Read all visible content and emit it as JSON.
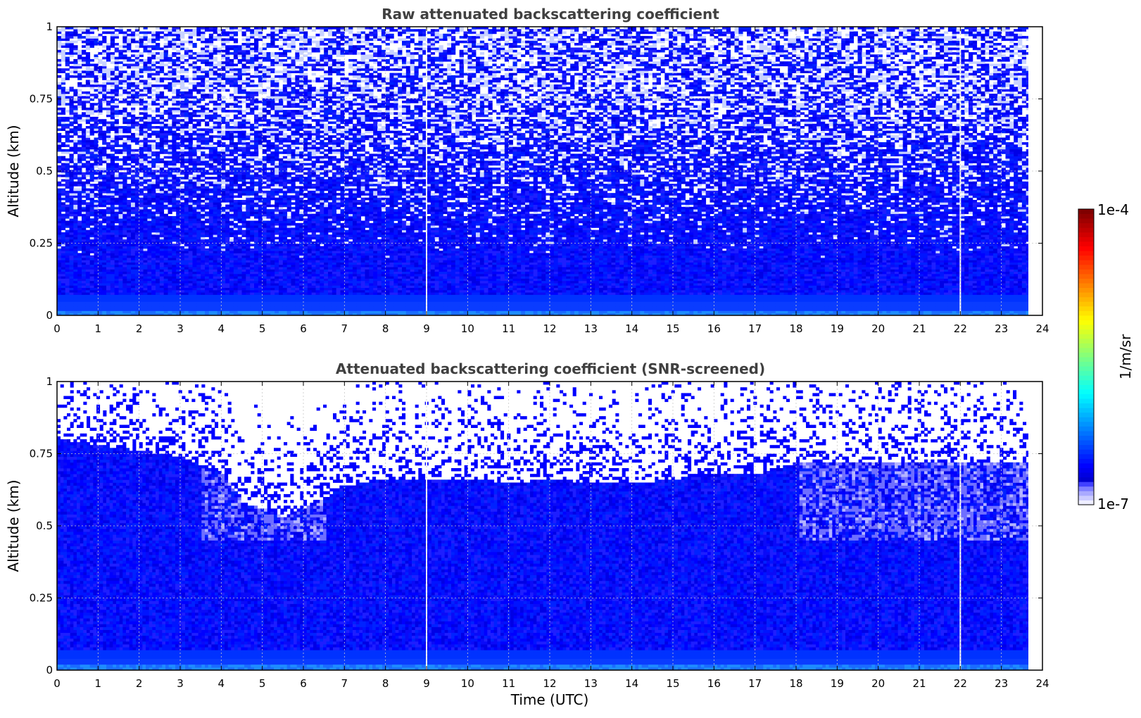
{
  "chart_data": [
    {
      "type": "heatmap",
      "title": "Raw attenuated backscattering coefficient",
      "xlabel": "",
      "ylabel": "Altitude (km)",
      "xlim": [
        0,
        24
      ],
      "ylim": [
        0,
        1
      ],
      "xticks": [
        "0",
        "1",
        "2",
        "3",
        "4",
        "5",
        "6",
        "7",
        "8",
        "9",
        "10",
        "11",
        "12",
        "13",
        "14",
        "15",
        "16",
        "17",
        "18",
        "19",
        "20",
        "21",
        "22",
        "23",
        "24"
      ],
      "yticks": [
        "0",
        "0.25",
        "0.5",
        "0.75",
        "1"
      ],
      "grid": true,
      "data_end_time": 23.65,
      "gaps_utc": [
        9.0,
        22.0
      ],
      "colorscale": "jet",
      "clim": [
        1e-07,
        0.0001
      ],
      "log_scale": true,
      "description_of_values": {
        "0.00-0.02 km": "bright blue, about 1e-6",
        "0.02-0.25 km": "blue, about 5e-7 to 8e-7",
        "0.25-0.5 km": "blue with sparse white speckle",
        "0.5-1.0 km": "mostly noisy white/blue speckle"
      }
    },
    {
      "type": "heatmap",
      "title": "Attenuated backscattering coefficient (SNR-screened)",
      "xlabel": "Time (UTC)",
      "ylabel": "Altitude (km)",
      "xlim": [
        0,
        24
      ],
      "ylim": [
        0,
        1
      ],
      "xticks": [
        "0",
        "1",
        "2",
        "3",
        "4",
        "5",
        "6",
        "7",
        "8",
        "9",
        "10",
        "11",
        "12",
        "13",
        "14",
        "15",
        "16",
        "17",
        "18",
        "19",
        "20",
        "21",
        "22",
        "23",
        "24"
      ],
      "yticks": [
        "0",
        "0.25",
        "0.5",
        "0.75",
        "1"
      ],
      "grid": true,
      "data_end_time": 23.65,
      "gaps_utc": [
        9.0,
        22.0
      ],
      "colorscale": "jet",
      "clim": [
        1e-07,
        0.0001
      ],
      "log_scale": true,
      "valid_top_km": {
        "hours": [
          0,
          1,
          2,
          3,
          4,
          4.5,
          5,
          5.5,
          6,
          6.5,
          7,
          8,
          9,
          10,
          11,
          12,
          13,
          14,
          15,
          16,
          17,
          18,
          19,
          20,
          21,
          22,
          23,
          23.65
        ],
        "altitude_km": [
          0.82,
          0.8,
          0.78,
          0.76,
          0.7,
          0.6,
          0.58,
          0.55,
          0.58,
          0.62,
          0.66,
          0.68,
          0.68,
          0.68,
          0.67,
          0.68,
          0.67,
          0.67,
          0.68,
          0.7,
          0.7,
          0.74,
          0.74,
          0.74,
          0.74,
          0.74,
          0.74,
          0.74
        ]
      }
    }
  ],
  "colorbar": {
    "max_label": "1e-4",
    "min_label": "1e-7",
    "unit_label": "1/m/sr"
  }
}
